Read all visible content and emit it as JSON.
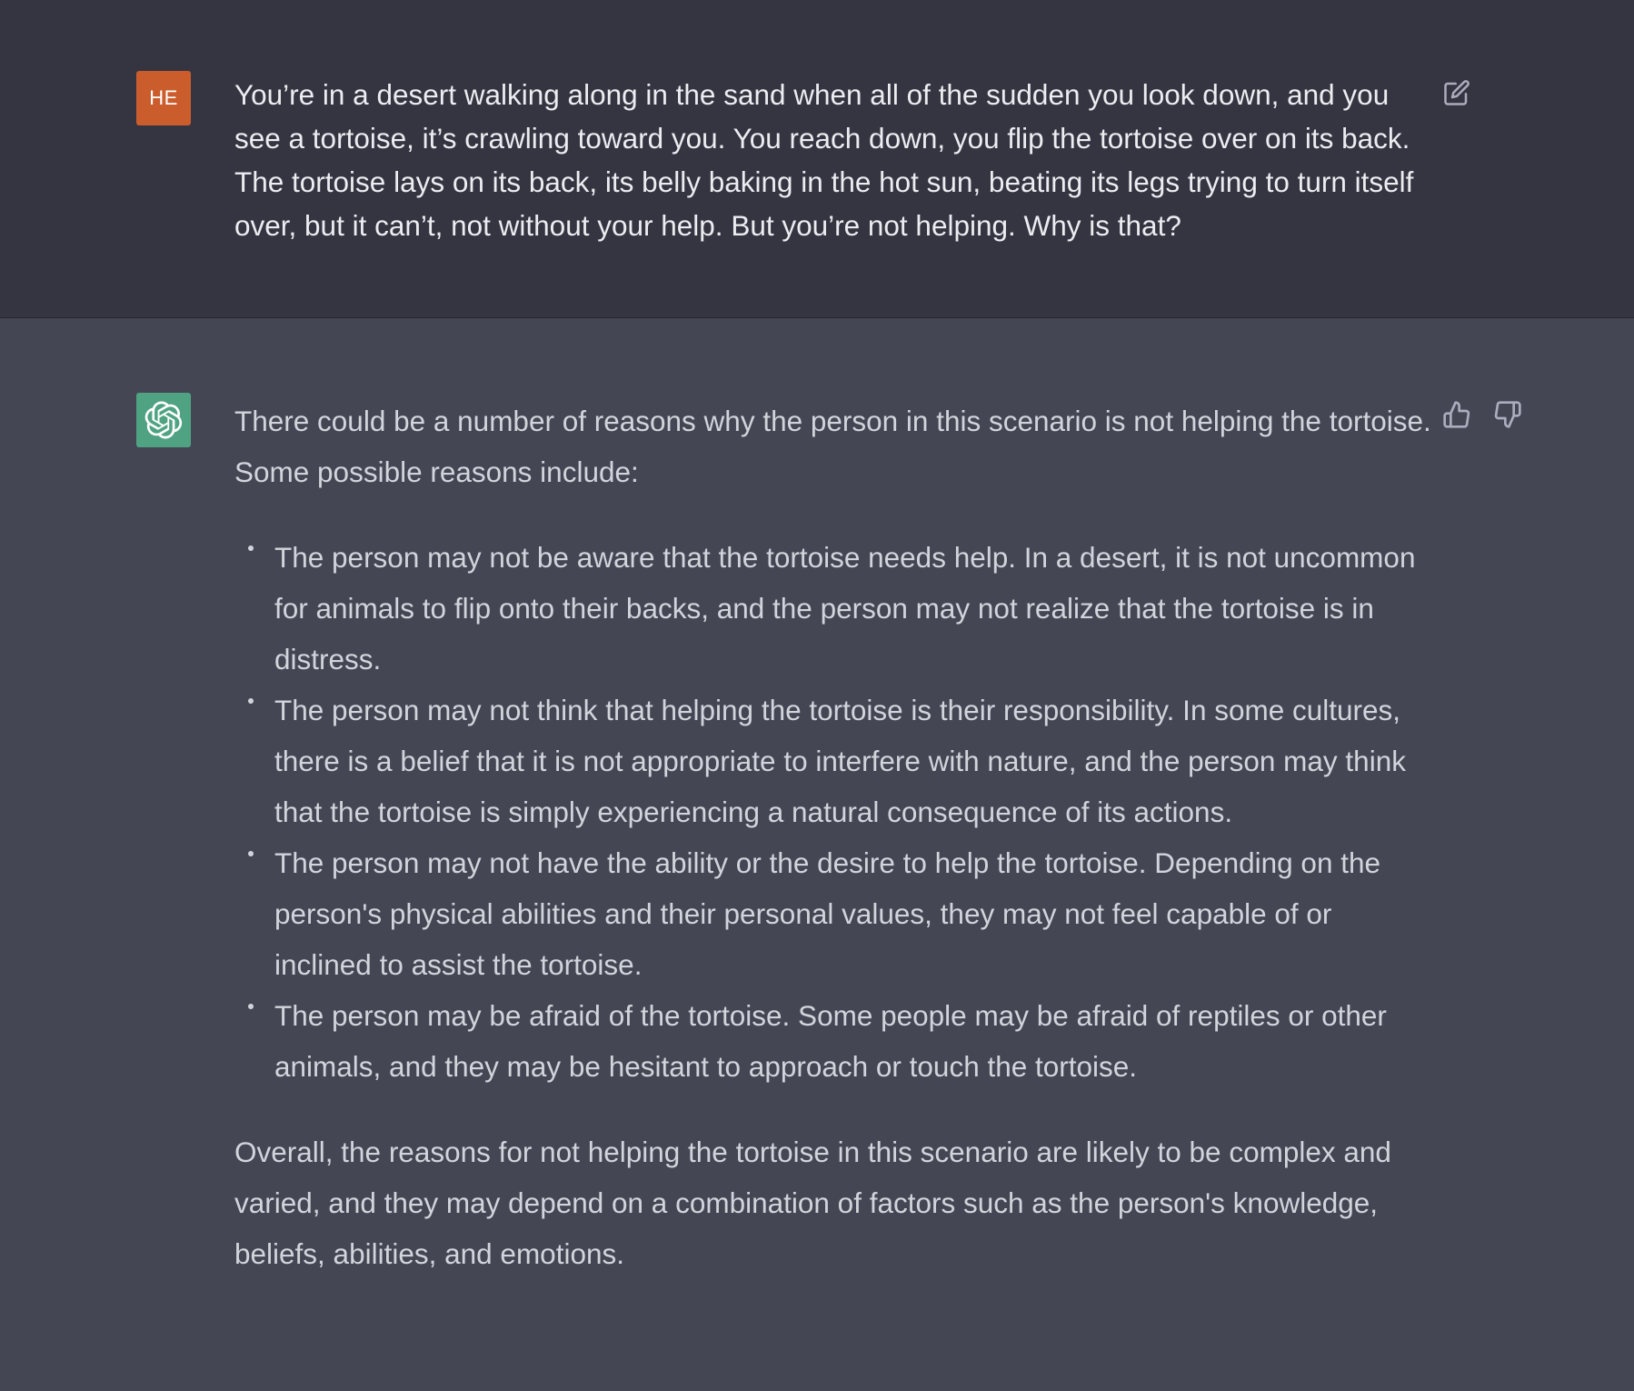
{
  "user_turn": {
    "avatar_initials": "HE",
    "avatar_color": "#cb5d2d",
    "message": "You’re in a desert walking along in the sand when all of the sudden you look down, and you see a tortoise, it’s crawling toward you. You reach down, you flip the tortoise over on its back. The tortoise lays on its back, its belly baking in the hot sun, beating its legs trying to turn itself over, but it can’t, not without your help. But you’re not helping. Why is that?",
    "edit_icon": "edit-icon"
  },
  "assistant_turn": {
    "avatar_icon": "openai-logo-icon",
    "avatar_color": "#4fa382",
    "intro": "There could be a number of reasons why the person in this scenario is not helping the tortoise. Some possible reasons include:",
    "reasons": [
      "The person may not be aware that the tortoise needs help. In a desert, it is not uncommon for animals to flip onto their backs, and the person may not realize that the tortoise is in distress.",
      "The person may not think that helping the tortoise is their responsibility. In some cultures, there is a belief that it is not appropriate to interfere with nature, and the person may think that the tortoise is simply experiencing a natural consequence of its actions.",
      "The person may not have the ability or the desire to help the tortoise. Depending on the person's physical abilities and their personal values, they may not feel capable of or inclined to assist the tortoise.",
      "The person may be afraid of the tortoise. Some people may be afraid of reptiles or other animals, and they may be hesitant to approach or touch the tortoise."
    ],
    "conclusion": "Overall, the reasons for not helping the tortoise in this scenario are likely to be complex and varied, and they may depend on a combination of factors such as the person's knowledge, beliefs, abilities, and emotions.",
    "thumbs_up_icon": "thumbs-up-icon",
    "thumbs_down_icon": "thumbs-down-icon"
  },
  "colors": {
    "user_bg": "#343541",
    "assistant_bg": "#444654",
    "user_text": "#ececf1",
    "assistant_text": "#d1d5db",
    "icon": "#acacbe"
  }
}
